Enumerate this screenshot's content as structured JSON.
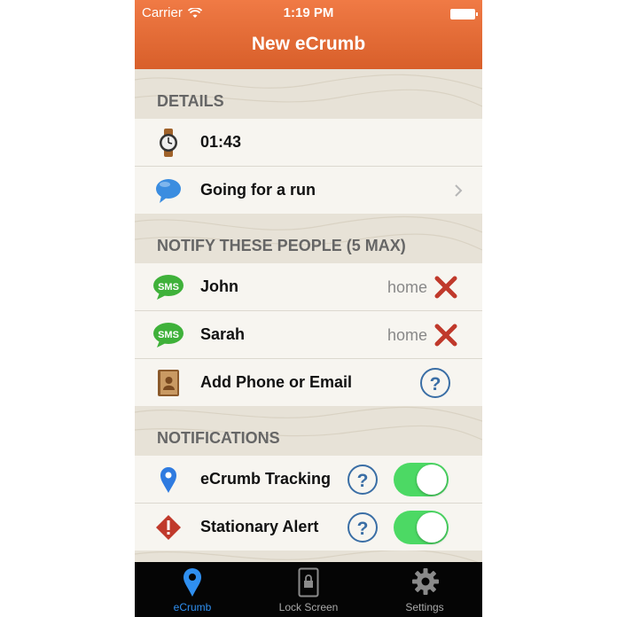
{
  "status_bar": {
    "carrier": "Carrier",
    "time": "1:19 PM"
  },
  "navbar": {
    "title": "New eCrumb"
  },
  "details": {
    "header": "DETAILS",
    "rows": [
      {
        "icon": "watch-icon",
        "label": "01:43"
      },
      {
        "icon": "speech-bubble-icon",
        "label": "Going for a run"
      }
    ]
  },
  "notify": {
    "header": "NOTIFY THESE PEOPLE (5 MAX)",
    "contacts": [
      {
        "icon": "sms-icon",
        "name": "John",
        "type": "home"
      },
      {
        "icon": "sms-icon",
        "name": "Sarah",
        "type": "home"
      }
    ],
    "add_label": "Add Phone or Email",
    "help": "?"
  },
  "notifications": {
    "header": "NOTIFICATIONS",
    "rows": [
      {
        "icon": "location-pin-icon",
        "label": "eCrumb Tracking",
        "help": "?",
        "enabled": true
      },
      {
        "icon": "warning-icon",
        "label": "Stationary Alert",
        "help": "?",
        "enabled": true
      }
    ]
  },
  "tabbar": {
    "tabs": [
      {
        "label": "eCrumb",
        "icon": "location-pin-icon",
        "active": true
      },
      {
        "label": "Lock Screen",
        "icon": "lock-screen-icon",
        "active": false
      },
      {
        "label": "Settings",
        "icon": "gear-icon",
        "active": false
      }
    ]
  },
  "colors": {
    "navbar": "#e8703b",
    "toggle_on": "#4cd964",
    "help": "#3a6ea5",
    "tab_active": "#2f8ff0",
    "delete": "#c0392b"
  }
}
